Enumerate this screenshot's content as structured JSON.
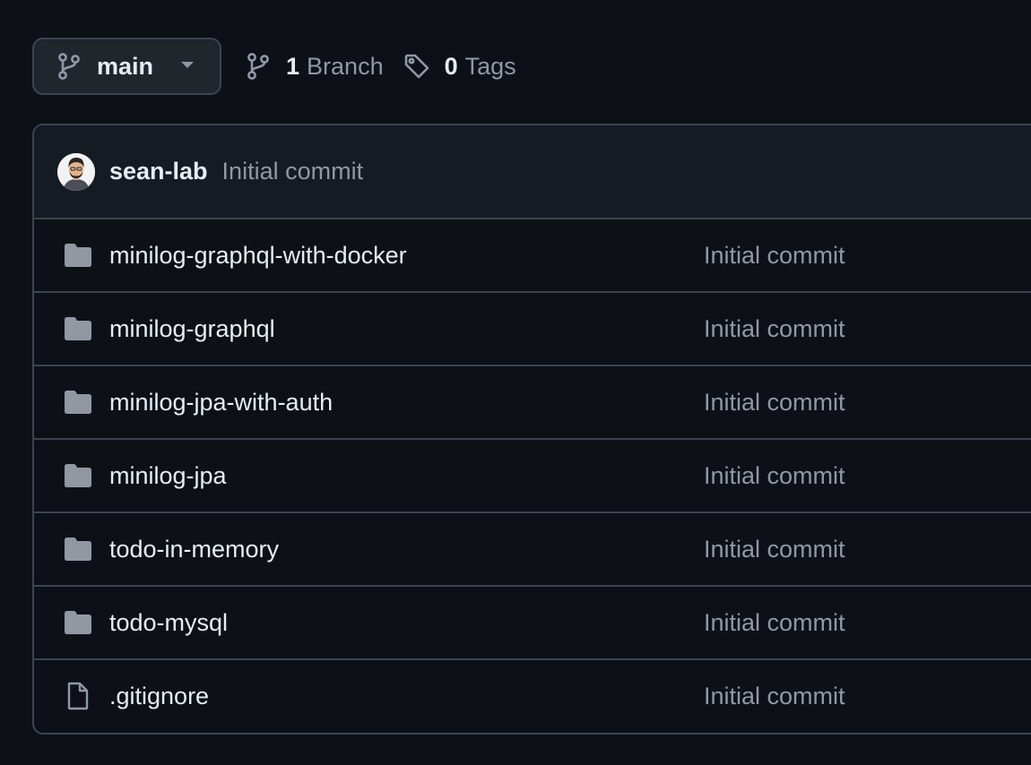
{
  "toolbar": {
    "branch_selector": {
      "label": "main",
      "icon": "git-branch-icon",
      "caret": "triangle-down-icon"
    },
    "branches": {
      "count": "1",
      "label": "Branch",
      "icon": "git-branch-icon"
    },
    "tags": {
      "count": "0",
      "label": "Tags",
      "icon": "tag-icon"
    }
  },
  "latest_commit": {
    "author": "sean-lab",
    "message": "Initial commit",
    "avatar": "user-avatar"
  },
  "files": [
    {
      "name": "minilog-graphql-with-docker",
      "type": "directory",
      "icon": "folder-icon",
      "commit_message": "Initial commit"
    },
    {
      "name": "minilog-graphql",
      "type": "directory",
      "icon": "folder-icon",
      "commit_message": "Initial commit"
    },
    {
      "name": "minilog-jpa-with-auth",
      "type": "directory",
      "icon": "folder-icon",
      "commit_message": "Initial commit"
    },
    {
      "name": "minilog-jpa",
      "type": "directory",
      "icon": "folder-icon",
      "commit_message": "Initial commit"
    },
    {
      "name": "todo-in-memory",
      "type": "directory",
      "icon": "folder-icon",
      "commit_message": "Initial commit"
    },
    {
      "name": "todo-mysql",
      "type": "directory",
      "icon": "folder-icon",
      "commit_message": "Initial commit"
    },
    {
      "name": ".gitignore",
      "type": "file",
      "icon": "file-icon",
      "commit_message": "Initial commit"
    }
  ],
  "colors": {
    "background": "#0d1117",
    "header_background": "#151b23",
    "border": "#3d444d",
    "text_primary": "#e6edf3",
    "text_muted": "#9198a1",
    "folder_icon": "#9198a1"
  }
}
